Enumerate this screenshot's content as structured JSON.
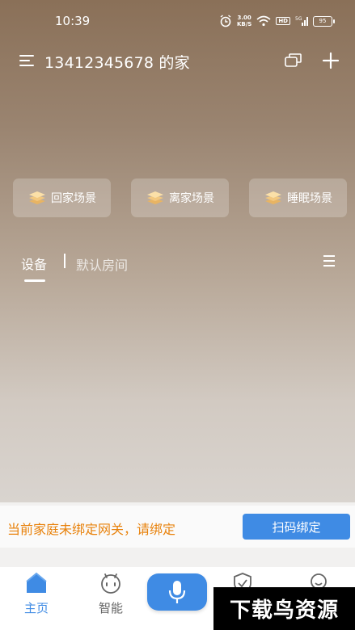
{
  "status_bar": {
    "time": "10:39",
    "net_speed_value": "3.00",
    "net_speed_unit": "KB/S",
    "hd": "HD",
    "signal": "5G",
    "battery": "95"
  },
  "header": {
    "title": "13412345678 的家",
    "icons": [
      "menu-icon",
      "switch-home-icon",
      "plus-icon"
    ]
  },
  "scenes": [
    {
      "label": "回家场景",
      "icon": "layers-icon"
    },
    {
      "label": "离家场景",
      "icon": "layers-icon"
    },
    {
      "label": "睡眠场景",
      "icon": "layers-icon"
    }
  ],
  "device_tabs": {
    "active": "设备",
    "room": "默认房间"
  },
  "gateway_notice": {
    "text": "当前家庭未绑定网关，请绑定",
    "button": "扫码绑定"
  },
  "tabbar": {
    "home": "主页",
    "smart": "智能"
  },
  "watermark": "下载鸟资源",
  "colors": {
    "accent": "#3f8be4",
    "warning_text": "#e8820c",
    "bg_top": "#8a7058"
  }
}
